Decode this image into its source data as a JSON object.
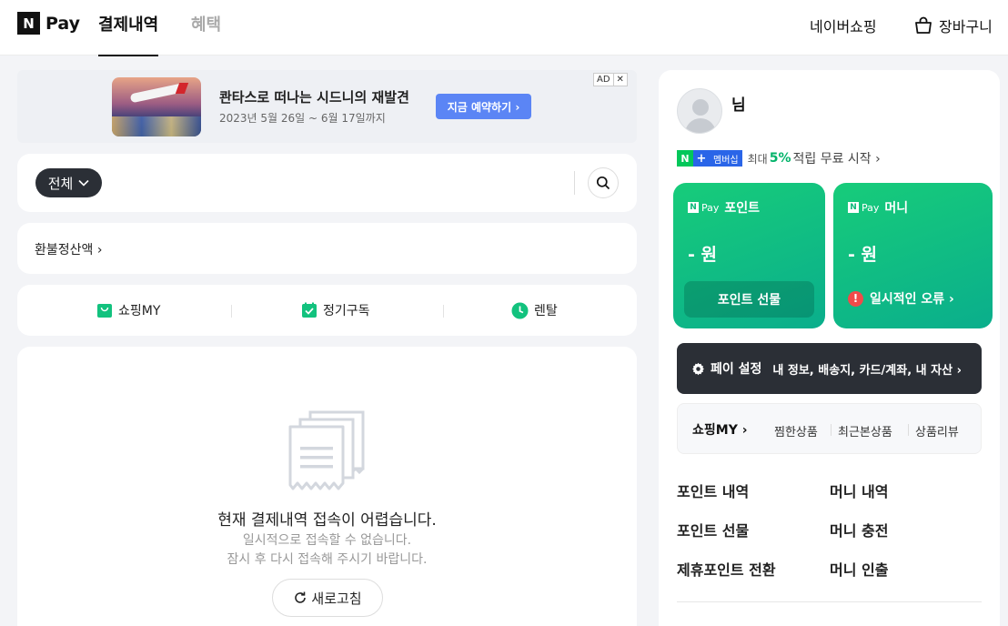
{
  "header": {
    "logo_n": "N",
    "logo_pay": "Pay",
    "tabs": [
      {
        "label": "결제내역",
        "active": true
      },
      {
        "label": "혜택",
        "active": false
      }
    ],
    "shopping_link": "네이버쇼핑",
    "cart_label": "장바구니"
  },
  "ad": {
    "title": "콴타스로 떠나는 시드니의 재발견",
    "subtitle": "2023년 5월 26일 ~ 6월 17일까지",
    "button": "지금 예약하기 ›",
    "badge_ad": "AD",
    "badge_close": "✕"
  },
  "filter": {
    "label": "전체",
    "chevron": "⌄"
  },
  "refund": {
    "label": "환불정산액 ›"
  },
  "quick_menu": [
    {
      "label": "쇼핑MY",
      "icon": "shopping-bag-icon",
      "color": "#12c27e"
    },
    {
      "label": "정기구독",
      "icon": "calendar-check-icon",
      "color": "#12c27e"
    },
    {
      "label": "렌탈",
      "icon": "clock-icon",
      "color": "#12c27e"
    }
  ],
  "empty": {
    "title": "현재 결제내역 접속이 어렵습니다.",
    "line1": "일시적으로 접속할 수 없습니다.",
    "line2": "잠시 후 다시 접속해 주시기 바랍니다.",
    "refresh": "새로고침"
  },
  "profile": {
    "name": "님",
    "membership_badge": "멤버십",
    "membership_prefix": "최대",
    "membership_pct": "5%",
    "membership_suffix": "적립 무료 시작 ›"
  },
  "point_card": {
    "pay": "Pay",
    "title": "포인트",
    "amount": "- 원",
    "button": "포인트 선물"
  },
  "money_card": {
    "pay": "Pay",
    "title": "머니",
    "amount": "- 원",
    "error": "일시적인 오류 ›"
  },
  "pay_setting": {
    "title": "페이 설정",
    "sub": "내 정보, 배송지, 카드/계좌, 내 자산 ›"
  },
  "shopping_my": {
    "title": "쇼핑MY ›",
    "links": [
      "찜한상품",
      "최근본상품",
      "상품리뷰"
    ]
  },
  "links": {
    "left": [
      "포인트 내역",
      "포인트 선물",
      "제휴포인트 전환"
    ],
    "right": [
      "머니 내역",
      "머니 충전",
      "머니 인출"
    ]
  },
  "colors": {
    "accent_green": "#12c27e",
    "dark": "#2b2f36",
    "ad_button": "#5b85f5",
    "error_red": "#f04a4a"
  }
}
